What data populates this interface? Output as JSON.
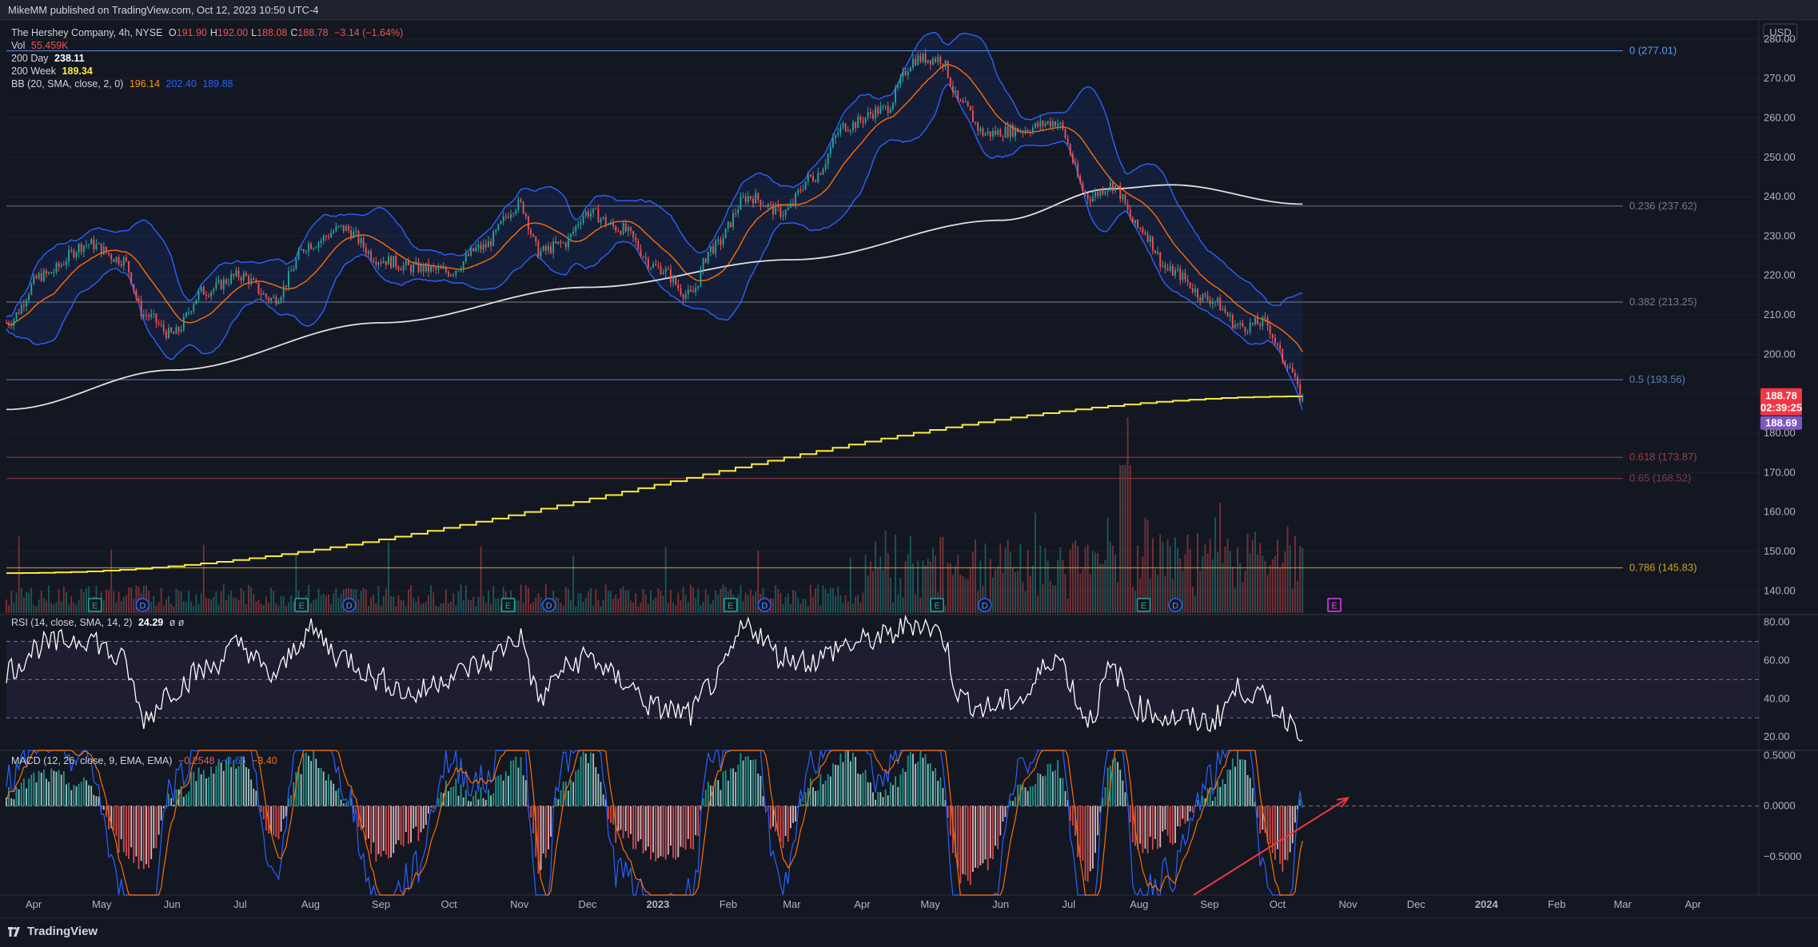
{
  "header": {
    "published": "MikeMM published on TradingView.com, Oct 12, 2023 10:50 UTC-4"
  },
  "legend": {
    "symbol": "The Hershey Company, 4h, NYSE",
    "ohlc": [
      {
        "k": "O",
        "v": "191.90"
      },
      {
        "k": "H",
        "v": "192.00"
      },
      {
        "k": "L",
        "v": "188.08"
      },
      {
        "k": "C",
        "v": "188.78"
      }
    ],
    "change": "−3.14 (−1.64%)",
    "vol_label": "Vol",
    "vol_value": "55.459K",
    "ma200d_label": "200 Day",
    "ma200d_value": "238.11",
    "ma200w_label": "200 Week",
    "ma200w_value": "189.34",
    "bb_label": "BB (20, SMA, close, 2, 0)",
    "bb_values": [
      "196.14",
      "202.40",
      "189.88"
    ],
    "rsi_label": "RSI (14, close, SMA, 14, 2)",
    "rsi_value": "24.29",
    "rsi_extra": "ø ø",
    "macd_label": "MACD (12, 26, close, 9, EMA, EMA)",
    "macd_values": [
      "−0.2548",
      "−3.66",
      "−3.40"
    ]
  },
  "axis": {
    "currency": "USD",
    "price_ticks": [
      "280.00",
      "270.00",
      "260.00",
      "250.00",
      "240.00",
      "230.00",
      "220.00",
      "210.00",
      "200.00",
      "190.00",
      "180.00",
      "170.00",
      "160.00",
      "150.00",
      "140.00"
    ],
    "rsi_ticks": [
      "80.00",
      "60.00",
      "40.00",
      "20.00"
    ],
    "macd_ticks": [
      "0.5000",
      "0.0000",
      "−0.5000"
    ],
    "x_ticks": [
      "Apr",
      "May",
      "Jun",
      "Jul",
      "Aug",
      "Sep",
      "Oct",
      "Nov",
      "Dec",
      "2023",
      "Feb",
      "Mar",
      "Apr",
      "May",
      "Jun",
      "Jul",
      "Aug",
      "Sep",
      "Oct",
      "Nov",
      "Dec",
      "2024",
      "Feb",
      "Mar",
      "Apr"
    ]
  },
  "price_tags": {
    "close": "188.78",
    "countdown": "02:39:25",
    "ma200w": "188.69"
  },
  "fib_levels": [
    {
      "label": "0 (277.01)",
      "price": 277.01,
      "color": "#5b9cf6"
    },
    {
      "label": "0.236 (237.62)",
      "price": 237.62,
      "color": "#787b86"
    },
    {
      "label": "0.382 (213.25)",
      "price": 213.25,
      "color": "#787b86"
    },
    {
      "label": "0.5 (193.56)",
      "price": 193.56,
      "color": "#5b7fb0"
    },
    {
      "label": "0.618 (173.87)",
      "price": 173.87,
      "color": "#a33b3b"
    },
    {
      "label": "0.65 (168.52)",
      "price": 168.52,
      "color": "#8a3a4a"
    },
    {
      "label": "0.786 (145.83)",
      "price": 145.83,
      "color": "#c9a227"
    }
  ],
  "events": [
    {
      "type": "E",
      "date": "2022-04-28"
    },
    {
      "type": "D",
      "date": "2022-05-19"
    },
    {
      "type": "E",
      "date": "2022-07-28"
    },
    {
      "type": "D",
      "date": "2022-08-18"
    },
    {
      "type": "E",
      "date": "2022-10-27"
    },
    {
      "type": "D",
      "date": "2022-11-14"
    },
    {
      "type": "E",
      "date": "2023-02-02"
    },
    {
      "type": "D",
      "date": "2023-02-17"
    },
    {
      "type": "E",
      "date": "2023-05-04"
    },
    {
      "type": "D",
      "date": "2023-05-25"
    },
    {
      "type": "E",
      "date": "2023-08-03"
    },
    {
      "type": "D",
      "date": "2023-08-17"
    },
    {
      "type": "E",
      "date": "2023-10-26",
      "upcoming": true
    }
  ],
  "colors": {
    "background": "#131722",
    "up": "#26a69a",
    "down": "#ef5350",
    "bb": "#2962ff",
    "basis": "#ff6d00",
    "ma200d": "#e0e0e0",
    "ma200w": "#ffeb3b",
    "rsi": "#ffffff",
    "macd": "#2962ff",
    "signal": "#ff6d00",
    "close_tag": "#f23645",
    "ma200w_tag": "#7e57c2"
  },
  "chart_data": [
    {
      "type": "candlestick",
      "title": "The Hershey Company, 4h, NYSE",
      "x_range": [
        "2022-03-20",
        "2024-04-30"
      ],
      "ylim": [
        136,
        283
      ],
      "series": [
        {
          "name": "price",
          "x": [
            "2022-03-20",
            "2022-04-05",
            "2022-04-25",
            "2022-05-10",
            "2022-05-20",
            "2022-06-01",
            "2022-06-15",
            "2022-07-01",
            "2022-07-15",
            "2022-08-01",
            "2022-08-15",
            "2022-09-01",
            "2022-09-15",
            "2022-10-01",
            "2022-10-15",
            "2022-11-01",
            "2022-11-10",
            "2022-11-20",
            "2022-12-01",
            "2022-12-15",
            "2023-01-01",
            "2023-01-15",
            "2023-01-25",
            "2023-02-10",
            "2023-02-25",
            "2023-03-10",
            "2023-03-25",
            "2023-04-10",
            "2023-04-25",
            "2023-05-05",
            "2023-05-15",
            "2023-05-25",
            "2023-06-10",
            "2023-06-25",
            "2023-07-10",
            "2023-07-20",
            "2023-08-01",
            "2023-08-15",
            "2023-09-01",
            "2023-09-15",
            "2023-09-25",
            "2023-10-05",
            "2023-10-12"
          ],
          "values": [
            208,
            220,
            228,
            224,
            210,
            205,
            216,
            220,
            214,
            228,
            232,
            224,
            222,
            221,
            227,
            238,
            226,
            228,
            236,
            232,
            222,
            215,
            227,
            240,
            236,
            245,
            258,
            262,
            275,
            275,
            263,
            256,
            257,
            259,
            240,
            243,
            232,
            221,
            214,
            207,
            208,
            198,
            188.78
          ]
        },
        {
          "name": "200 Day",
          "x": [
            "2022-03-20",
            "2022-06-01",
            "2022-09-01",
            "2022-12-01",
            "2023-03-01",
            "2023-06-01",
            "2023-07-20",
            "2023-08-15",
            "2023-10-12"
          ],
          "values": [
            186,
            196,
            208,
            217,
            224,
            234,
            242,
            243,
            238.11
          ]
        },
        {
          "name": "200 Week",
          "x": [
            "2022-03-20",
            "2023-10-12"
          ],
          "values": [
            144.5,
            189.34
          ]
        }
      ],
      "volume": {
        "peak_date": "2023-07-26",
        "last": "55.459K"
      }
    },
    {
      "type": "line",
      "title": "RSI (14, close, SMA, 14, 2)",
      "ylim": [
        13,
        84
      ],
      "bands": [
        30,
        50,
        70
      ],
      "series": [
        {
          "name": "RSI",
          "x": [
            "2022-03-20",
            "2022-04-05",
            "2022-04-25",
            "2022-05-10",
            "2022-05-20",
            "2022-06-01",
            "2022-06-15",
            "2022-07-01",
            "2022-07-15",
            "2022-08-01",
            "2022-08-15",
            "2022-09-01",
            "2022-09-15",
            "2022-10-01",
            "2022-10-15",
            "2022-11-01",
            "2022-11-10",
            "2022-11-20",
            "2022-12-01",
            "2022-12-15",
            "2023-01-01",
            "2023-01-15",
            "2023-01-25",
            "2023-02-10",
            "2023-02-25",
            "2023-03-10",
            "2023-03-25",
            "2023-04-10",
            "2023-04-25",
            "2023-05-05",
            "2023-05-15",
            "2023-05-25",
            "2023-06-10",
            "2023-06-25",
            "2023-07-10",
            "2023-07-20",
            "2023-08-01",
            "2023-08-15",
            "2023-09-01",
            "2023-09-15",
            "2023-09-25",
            "2023-10-05",
            "2023-10-12"
          ],
          "values": [
            55,
            68,
            72,
            60,
            30,
            45,
            55,
            68,
            52,
            75,
            62,
            50,
            42,
            52,
            58,
            72,
            40,
            55,
            62,
            50,
            35,
            32,
            48,
            78,
            62,
            60,
            68,
            72,
            80,
            75,
            40,
            35,
            40,
            62,
            30,
            55,
            35,
            30,
            28,
            45,
            40,
            30,
            24.29
          ]
        }
      ]
    },
    {
      "type": "histogram",
      "title": "MACD (12, 26, close, 9, EMA, EMA)",
      "ylim": [
        -0.88,
        0.55
      ],
      "series": [
        {
          "name": "Histogram",
          "x": [
            "2022-03-20",
            "2022-04-05",
            "2022-04-25",
            "2022-05-10",
            "2022-05-20",
            "2022-06-01",
            "2022-06-15",
            "2022-07-01",
            "2022-07-15",
            "2022-08-01",
            "2022-08-15",
            "2022-09-01",
            "2022-09-15",
            "2022-10-01",
            "2022-10-15",
            "2022-11-01",
            "2022-11-10",
            "2022-11-20",
            "2022-12-01",
            "2022-12-15",
            "2023-01-01",
            "2023-01-15",
            "2023-01-25",
            "2023-02-10",
            "2023-02-25",
            "2023-03-10",
            "2023-03-25",
            "2023-04-10",
            "2023-04-25",
            "2023-05-05",
            "2023-05-15",
            "2023-05-25",
            "2023-06-10",
            "2023-06-25",
            "2023-07-10",
            "2023-07-20",
            "2023-08-01",
            "2023-08-15",
            "2023-09-01",
            "2023-09-15",
            "2023-09-25",
            "2023-10-05",
            "2023-10-12"
          ],
          "values": [
            0.1,
            0.3,
            0.2,
            -0.4,
            -0.6,
            0.1,
            0.35,
            0.45,
            -0.3,
            0.5,
            0.1,
            -0.5,
            -0.3,
            0.2,
            0.1,
            0.45,
            -0.6,
            0.2,
            0.5,
            -0.3,
            -0.5,
            -0.4,
            0.2,
            0.5,
            -0.4,
            0.2,
            0.5,
            0.1,
            0.5,
            0.3,
            -0.75,
            -0.6,
            0.2,
            0.4,
            -0.7,
            0.5,
            -0.4,
            -0.3,
            0.1,
            0.5,
            -0.3,
            -0.6,
            0.05
          ]
        }
      ],
      "annotation": {
        "type": "arrow",
        "from": [
          "2023-08-25",
          -0.88
        ],
        "to": [
          "2023-11-01",
          0.08
        ]
      }
    }
  ]
}
